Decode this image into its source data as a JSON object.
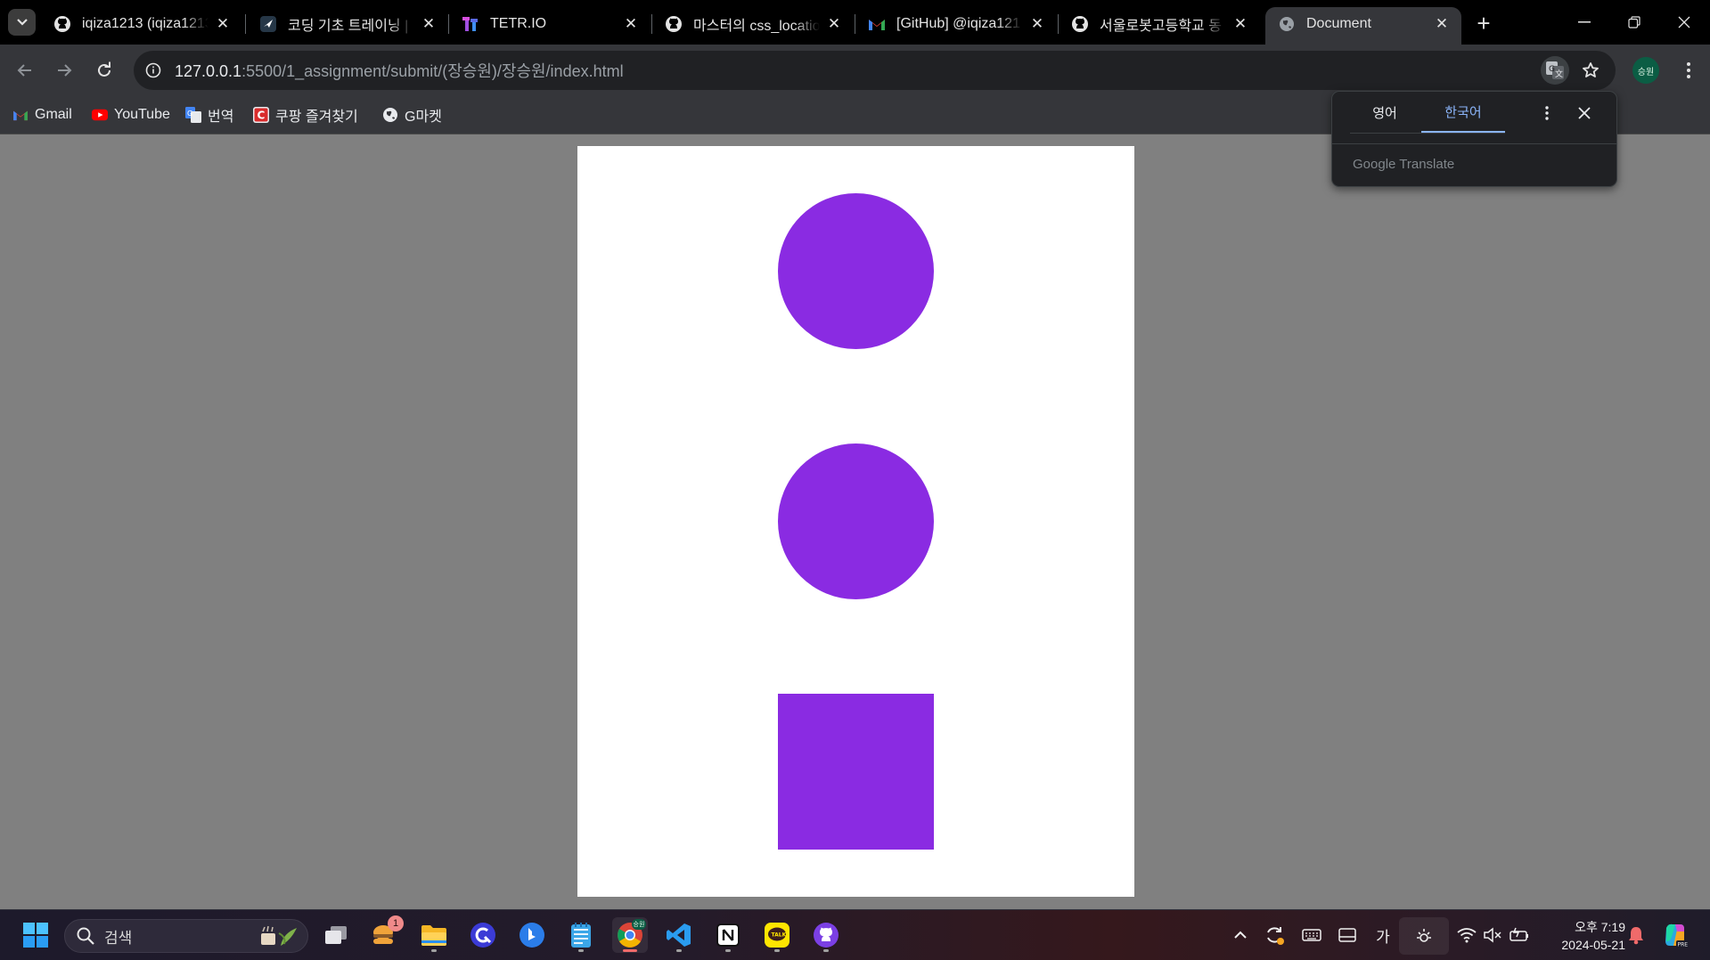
{
  "browser": {
    "tabs": [
      {
        "title": "iqiza1213 (iqiza1213",
        "favicon": "github-icon",
        "active": false
      },
      {
        "title": "코딩 기초 트레이닝 |",
        "favicon": "programmers-icon",
        "active": false
      },
      {
        "title": "TETR.IO",
        "favicon": "tetrio-icon",
        "active": false
      },
      {
        "title": "마스터의 css_locatio",
        "favicon": "github-icon",
        "active": false
      },
      {
        "title": "[GitHub] @iqiza121",
        "favicon": "gmail-icon",
        "active": false
      },
      {
        "title": "서울로봇고등학교 동",
        "favicon": "github-icon",
        "active": false
      },
      {
        "title": "Document",
        "favicon": "globe-icon",
        "active": true
      }
    ],
    "url_host": "127.0.0.1",
    "url_rest": ":5500/1_assignment/submit/(장승원)/장승원/index.html",
    "profile_initials": "승원",
    "bookmarks": [
      {
        "label": "Gmail",
        "icon": "gmail-icon"
      },
      {
        "label": "YouTube",
        "icon": "youtube-icon"
      },
      {
        "label": "번역",
        "icon": "google-translate-icon"
      },
      {
        "label": "쿠팡 즐겨찾기",
        "icon": "coupang-icon"
      },
      {
        "label": "G마켓",
        "icon": "globe-icon"
      }
    ]
  },
  "translate_popup": {
    "tabs": [
      "영어",
      "한국어"
    ],
    "active_tab": "한국어",
    "brand": "Google Translate"
  },
  "page": {
    "shapes": [
      {
        "type": "circle",
        "color": "#8a2be2"
      },
      {
        "type": "circle",
        "color": "#8a2be2"
      },
      {
        "type": "square",
        "color": "#8a2be2"
      }
    ]
  },
  "taskbar": {
    "search_label": "검색",
    "notification_badge": "1",
    "ime_label": "가",
    "time": "오후 7:19",
    "date": "2024-05-21",
    "apps": [
      "task-view",
      "weather-widget",
      "file-explorer",
      "search-app",
      "bing",
      "notepad",
      "chrome",
      "vscode",
      "notion",
      "kakaotalk",
      "github-desktop"
    ]
  },
  "colors": {
    "accent": "#8ab4f8",
    "shape": "#8a2be2",
    "page_bg": "#808080"
  }
}
